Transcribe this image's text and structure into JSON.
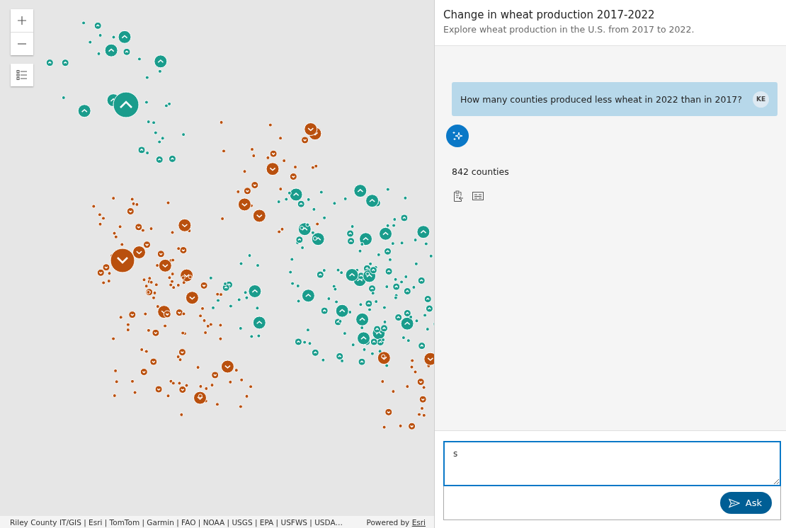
{
  "map": {
    "attribution": "Riley County IT/GIS | Esri | TomTom | Garmin | FAO | NOAA | USGS | EPA | USFWS | USDA…",
    "powered_by": "Powered by",
    "powered_link": "Esri"
  },
  "panel": {
    "title": "Change in wheat production 2017-2022",
    "subtitle": "Explore wheat production in the U.S. from 2017 to 2022."
  },
  "messages": [
    {
      "kind": "user",
      "text": "How many counties produced less wheat in 2022 than in 2017?",
      "initials": "KE"
    },
    {
      "kind": "assistant",
      "text": "842 counties"
    }
  ],
  "composer": {
    "value": "s",
    "button": "Ask"
  }
}
